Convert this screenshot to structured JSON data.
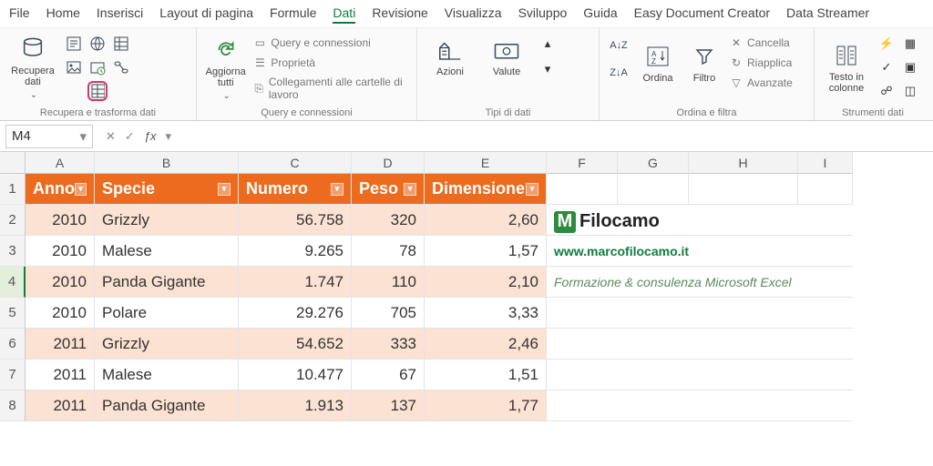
{
  "menu": [
    "File",
    "Home",
    "Inserisci",
    "Layout di pagina",
    "Formule",
    "Dati",
    "Revisione",
    "Visualizza",
    "Sviluppo",
    "Guida",
    "Easy Document Creator",
    "Data Streamer"
  ],
  "active_menu_index": 5,
  "ribbon": {
    "group1": {
      "label": "Recupera e trasforma dati",
      "btn_recupera": "Recupera dati"
    },
    "group2": {
      "label": "Query e connessioni",
      "btn_aggiorna": "Aggiorna tutti",
      "items": [
        "Query e connessioni",
        "Proprietà",
        "Collegamenti alle cartelle di lavoro"
      ]
    },
    "group3": {
      "label": "Tipi di dati",
      "btn_azioni": "Azioni",
      "btn_valute": "Valute"
    },
    "group4": {
      "label": "Ordina e filtra",
      "btn_ordina": "Ordina",
      "btn_filtro": "Filtro",
      "items": [
        "Cancella",
        "Riapplica",
        "Avanzate"
      ]
    },
    "group5": {
      "label": "Strumenti dati",
      "btn_testo": "Testo in colonne"
    }
  },
  "namebox": "M4",
  "formula": "",
  "cols": [
    "A",
    "B",
    "C",
    "D",
    "E",
    "F",
    "G",
    "H",
    "I"
  ],
  "rows_visible": [
    1,
    2,
    3,
    4,
    5,
    6,
    7,
    8
  ],
  "selected_row": 4,
  "headers": [
    "Anno",
    "Specie",
    "Numero",
    "Peso",
    "Dimensione"
  ],
  "data": [
    {
      "anno": "2010",
      "specie": "Grizzly",
      "numero": "56.758",
      "peso": "320",
      "dim": "2,60"
    },
    {
      "anno": "2010",
      "specie": "Malese",
      "numero": "9.265",
      "peso": "78",
      "dim": "1,57"
    },
    {
      "anno": "2010",
      "specie": "Panda Gigante",
      "numero": "1.747",
      "peso": "110",
      "dim": "2,10"
    },
    {
      "anno": "2010",
      "specie": "Polare",
      "numero": "29.276",
      "peso": "705",
      "dim": "3,33"
    },
    {
      "anno": "2011",
      "specie": "Grizzly",
      "numero": "54.652",
      "peso": "333",
      "dim": "2,46"
    },
    {
      "anno": "2011",
      "specie": "Malese",
      "numero": "10.477",
      "peso": "67",
      "dim": "1,51"
    },
    {
      "anno": "2011",
      "specie": "Panda Gigante",
      "numero": "1.913",
      "peso": "137",
      "dim": "1,77"
    }
  ],
  "side": {
    "brand": "Filocamo",
    "url": "www.marcofilocamo.it",
    "tagline": "Formazione & consulenza Microsoft Excel"
  }
}
